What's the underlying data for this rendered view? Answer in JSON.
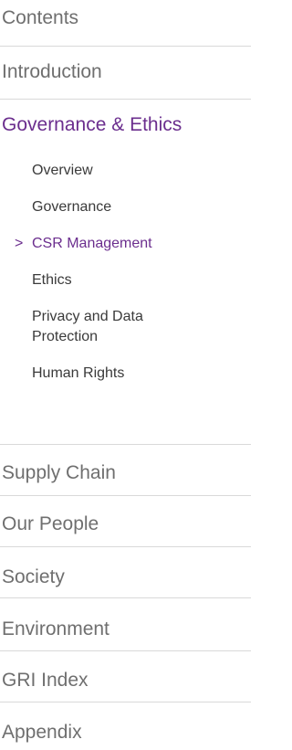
{
  "toc": {
    "heading": "Contents",
    "sections": [
      {
        "label": "Introduction"
      },
      {
        "label": "Governance & Ethics"
      },
      {
        "label": "Supply Chain"
      },
      {
        "label": "Our People"
      },
      {
        "label": "Society"
      },
      {
        "label": "Environment"
      },
      {
        "label": "GRI Index"
      },
      {
        "label": "Appendix"
      }
    ],
    "active_section_subitems": [
      {
        "label": "Overview"
      },
      {
        "label": "Governance"
      },
      {
        "label": "CSR Management"
      },
      {
        "label": "Ethics"
      },
      {
        "label": "Privacy and Data Protection"
      },
      {
        "label": "Human Rights"
      }
    ],
    "current_marker": ">",
    "colors": {
      "active": "#6b2e8e",
      "muted": "#6f6f6f",
      "text": "#3a3a3a",
      "divider": "#d9d9d9"
    }
  }
}
